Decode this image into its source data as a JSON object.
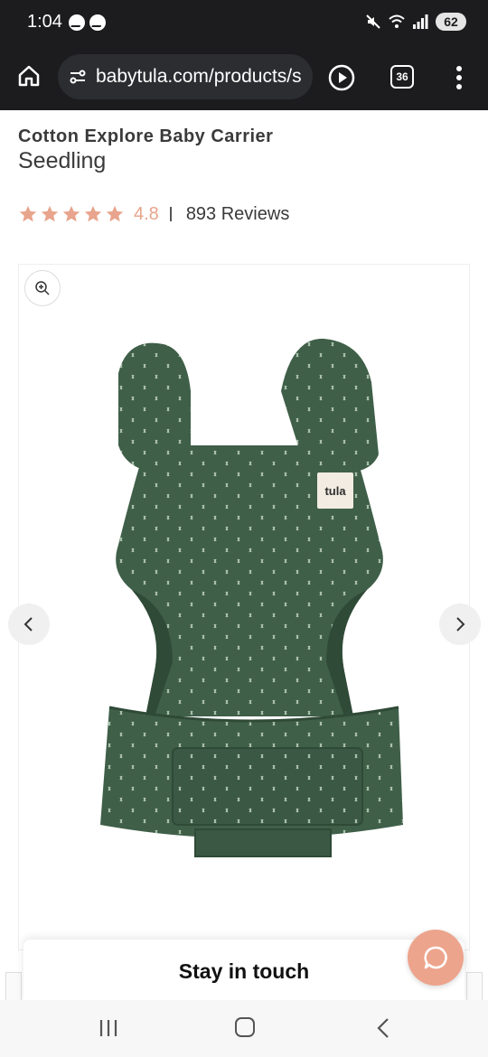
{
  "status_bar": {
    "time": "1:04",
    "battery": "62",
    "icons": [
      "messenger-icon",
      "messenger-icon",
      "mute-icon",
      "wifi-icon",
      "signal-icon",
      "battery-icon"
    ]
  },
  "browser": {
    "url": "babytula.com/products/s",
    "tab_count": "36",
    "icons": [
      "home-icon",
      "site-settings-icon",
      "play-icon",
      "tabs-icon",
      "overflow-menu-icon"
    ]
  },
  "product": {
    "name": "Cotton Explore Baby Carrier",
    "variant": "Seedling",
    "rating": "4.8",
    "reviews": "893 Reviews",
    "stars_filled": 5
  },
  "gallery": {
    "icons": [
      "zoom-in-icon",
      "chevron-left-icon",
      "chevron-right-icon"
    ],
    "label_tag": "tula"
  },
  "popup": {
    "title": "Stay in touch"
  },
  "colors": {
    "star": "#e8a48c",
    "chat_button": "#eda48c",
    "carrier_green": "#3f5f48",
    "dark_bar": "#1c1c1e"
  }
}
